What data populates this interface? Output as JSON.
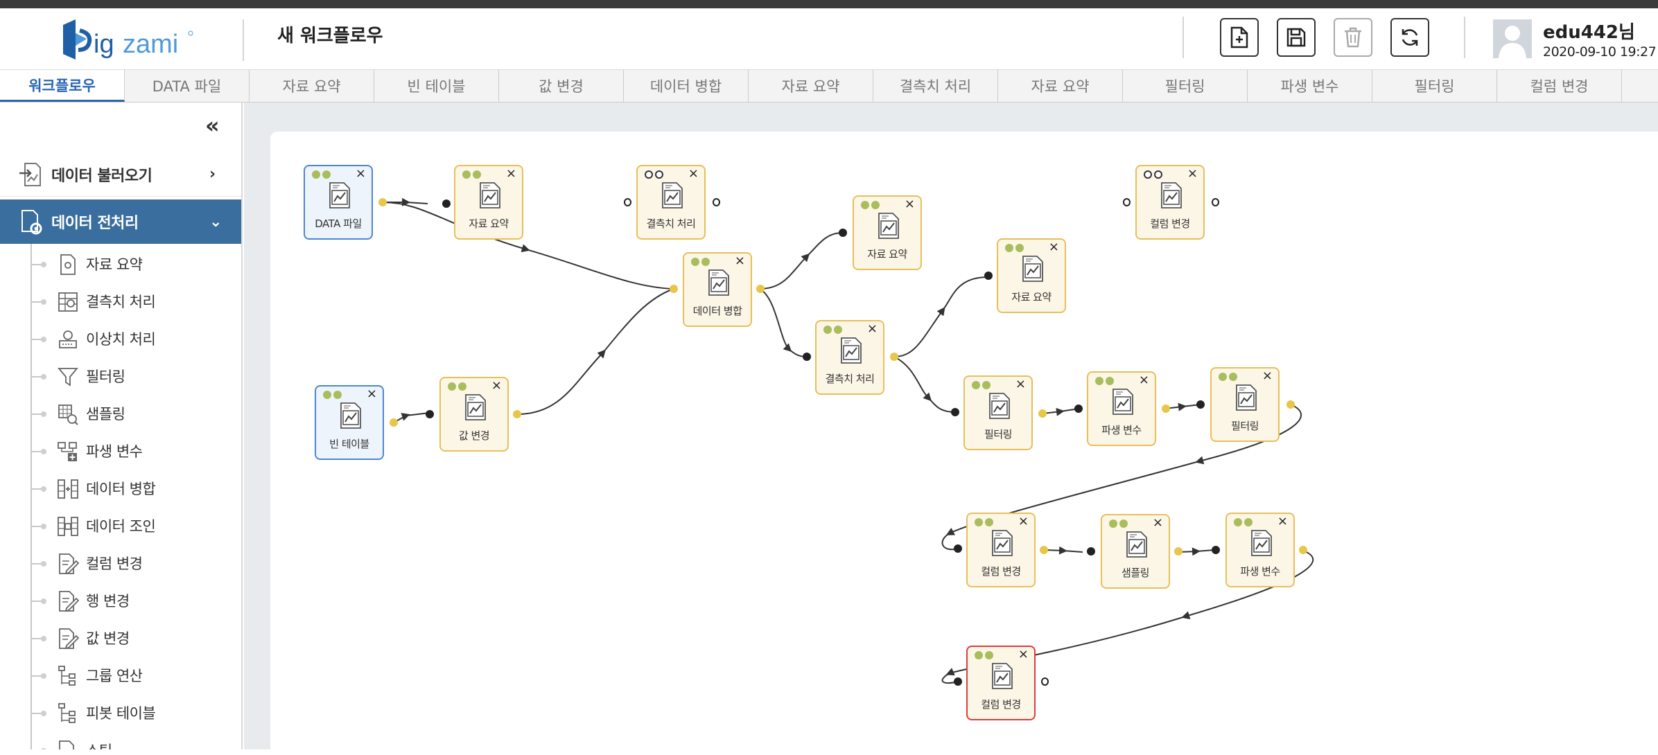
{
  "app": {
    "logo_text": "bigzami",
    "workflow_title": "새 워크플로우"
  },
  "toolbar": {
    "buttons": [
      {
        "name": "new-workflow"
      },
      {
        "name": "save"
      },
      {
        "name": "delete",
        "disabled": true
      },
      {
        "name": "refresh"
      }
    ]
  },
  "user": {
    "name": "edu442님",
    "datetime": "2020-09-10 19:27"
  },
  "tabs": [
    "워크플로우",
    "DATA 파일",
    "자료 요약",
    "빈 테이블",
    "값 변경",
    "데이터 병합",
    "자료 요약",
    "결측치 처리",
    "자료 요약",
    "필터링",
    "파생 변수",
    "필터링",
    "컬럼 변경"
  ],
  "active_tab": 0,
  "sidebar": {
    "collapse_glyph": "«",
    "load_label": "데이터 불러오기",
    "pre_label": "데이터 전처리",
    "items": [
      "자료 요약",
      "결측치 처리",
      "이상치 처리",
      "필터링",
      "샘플링",
      "파생 변수",
      "데이터 병합",
      "데이터 조인",
      "컬럼 변경",
      "행 변경",
      "값 변경",
      "그룹 연산",
      "피봇 테이블",
      "소팅"
    ]
  },
  "nodes": [
    {
      "id": "n1",
      "label": "DATA 파일",
      "variant": "data",
      "leds": [
        1,
        1
      ]
    },
    {
      "id": "n2",
      "label": "자료 요약",
      "variant": "normal",
      "leds": [
        1,
        1
      ]
    },
    {
      "id": "n3",
      "label": "결측치 처리",
      "variant": "normal",
      "leds": [
        0,
        0
      ]
    },
    {
      "id": "n4",
      "label": "데이터 병합",
      "variant": "normal",
      "leds": [
        1,
        1
      ]
    },
    {
      "id": "n5",
      "label": "자료 요약",
      "variant": "normal",
      "leds": [
        1,
        1
      ]
    },
    {
      "id": "n6",
      "label": "결측치 처리",
      "variant": "normal",
      "leds": [
        1,
        1
      ]
    },
    {
      "id": "n7",
      "label": "자료 요약",
      "variant": "normal",
      "leds": [
        1,
        1
      ]
    },
    {
      "id": "n8",
      "label": "컬럼 변경",
      "variant": "normal",
      "leds": [
        0,
        0
      ]
    },
    {
      "id": "n9",
      "label": "빈 테이블",
      "variant": "data",
      "leds": [
        1,
        1
      ]
    },
    {
      "id": "n10",
      "label": "값 변경",
      "variant": "normal",
      "leds": [
        1,
        1
      ]
    },
    {
      "id": "n11",
      "label": "필터링",
      "variant": "normal",
      "leds": [
        1,
        1
      ]
    },
    {
      "id": "n12",
      "label": "파생 변수",
      "variant": "normal",
      "leds": [
        1,
        1
      ]
    },
    {
      "id": "n13",
      "label": "필터링",
      "variant": "normal",
      "leds": [
        1,
        1
      ]
    },
    {
      "id": "n14",
      "label": "컬럼 변경",
      "variant": "normal",
      "leds": [
        1,
        1
      ]
    },
    {
      "id": "n15",
      "label": "샘플링",
      "variant": "normal",
      "leds": [
        1,
        1
      ]
    },
    {
      "id": "n16",
      "label": "파생 변수",
      "variant": "normal",
      "leds": [
        1,
        1
      ]
    },
    {
      "id": "n17",
      "label": "컬럼 변경",
      "variant": "error",
      "leds": [
        1,
        1
      ]
    }
  ],
  "close_glyph": "×",
  "colors": {
    "accent": "#2a66b3",
    "sidebar_active": "#3a6e9e",
    "node_border": "#e8bf5a",
    "data_node_border": "#4a86d8",
    "error_border": "#e03a3a",
    "led_on": "#a9bd5d",
    "port_out": "#e8c64a"
  }
}
